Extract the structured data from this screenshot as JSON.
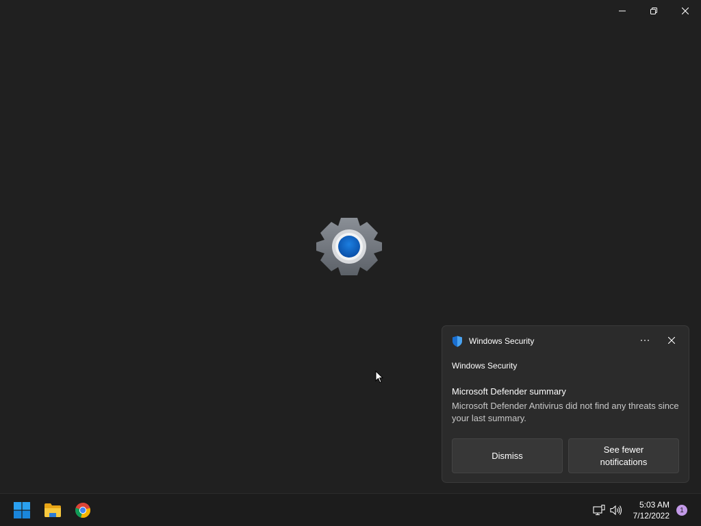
{
  "window": {
    "buttons": [
      {
        "name": "minimize",
        "icon": "minimize-icon"
      },
      {
        "name": "restore",
        "icon": "restore-icon"
      },
      {
        "name": "close",
        "icon": "close-icon"
      }
    ],
    "splash_icon": "settings-gear-icon"
  },
  "toast": {
    "app_name": "Windows Security",
    "attribution": "Windows Security",
    "title": "Microsoft Defender summary",
    "body": "Microsoft Defender Antivirus did not find any threats since your last summary.",
    "dismiss_label": "Dismiss",
    "fewer_label": "See fewer notifications",
    "more_icon": "more-icon",
    "close_icon": "close-icon",
    "app_icon": "shield-icon"
  },
  "taskbar": {
    "apps": [
      {
        "name": "Start",
        "icon": "windows-logo-icon"
      },
      {
        "name": "File Explorer",
        "icon": "folder-icon"
      },
      {
        "name": "Google Chrome",
        "icon": "chrome-icon"
      }
    ],
    "tray": {
      "network_icon": "network-icon",
      "volume_icon": "volume-icon"
    },
    "clock": {
      "time": "5:03 AM",
      "date": "7/12/2022"
    },
    "notification_count": "1"
  },
  "colors": {
    "background": "#202020",
    "taskbar": "#1c1c1c",
    "toast": "#2b2b2b",
    "badge": "#c39ae8",
    "accent_blue": "#0078d4"
  }
}
